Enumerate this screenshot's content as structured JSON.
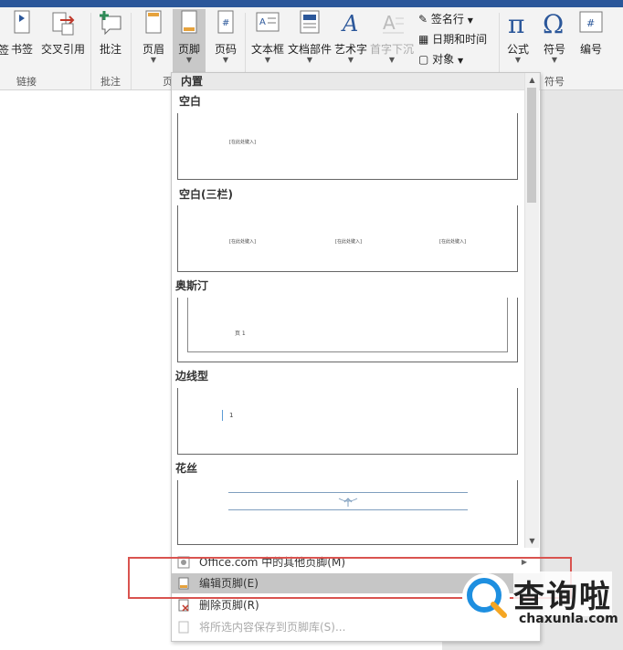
{
  "ribbon": {
    "buttons": {
      "partial": "签",
      "bookmark": "书签",
      "crossref": "交叉引用",
      "comment": "批注",
      "header": "页眉",
      "footer": "页脚",
      "pagenum": "页码",
      "textbox": "文本框",
      "quickparts": "文档部件",
      "wordart": "艺术字",
      "dropcap": "首字下沉",
      "signature": "签名行",
      "datetime": "日期和时间",
      "object": "对象",
      "equation": "公式",
      "symbol": "符号",
      "number": "编号"
    },
    "groups": {
      "links": "链接",
      "comments": "批注",
      "headerfooter_partial": "页",
      "symbols": "符号"
    }
  },
  "dropdown": {
    "header": "内置",
    "items": [
      {
        "label": "空白",
        "placeholder": "[在此处键入]"
      },
      {
        "label": "空白(三栏)",
        "placeholders": [
          "[在此处键入]",
          "[在此处键入]",
          "[在此处键入]"
        ]
      },
      {
        "label": "奥斯汀",
        "text": "页 1"
      },
      {
        "label": "边线型",
        "text": "1"
      },
      {
        "label": "花丝"
      }
    ],
    "menu": [
      {
        "label": "Office.com 中的其他页脚(M)",
        "enabled": true,
        "submenu": true
      },
      {
        "label": "编辑页脚(E)",
        "enabled": true,
        "highlighted": true
      },
      {
        "label": "删除页脚(R)",
        "enabled": true
      },
      {
        "label": "将所选内容保存到页脚库(S)...",
        "enabled": false
      }
    ]
  },
  "watermark": {
    "title": "查询啦",
    "url": "chaxunla.com"
  },
  "colors": {
    "accent": "#2b579a",
    "highlight": "#c8c8c8",
    "redbox": "#d9534f",
    "watermark_blue": "#1e8fe0",
    "watermark_orange": "#f5a623"
  }
}
